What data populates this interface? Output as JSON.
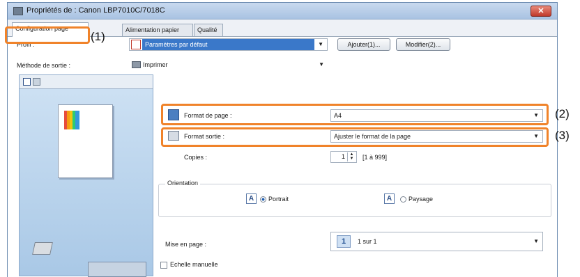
{
  "window": {
    "title": "Propriétés de : Canon LBP7010C/7018C",
    "close_symbol": "✕"
  },
  "tabs": [
    {
      "label": "Configuration page",
      "active": true
    },
    {
      "label": "Alimentation papier",
      "active": false
    },
    {
      "label": "Qualité",
      "active": false
    }
  ],
  "callouts": {
    "one": "(1)",
    "two": "(2)",
    "three": "(3)"
  },
  "profile": {
    "label": "Profil :",
    "value": "Paramètres par défaut",
    "add_button": "Ajouter(1)...",
    "edit_button": "Modifier(2)..."
  },
  "output_method": {
    "label": "Méthode de sortie :",
    "value": "Imprimer"
  },
  "page_size": {
    "label": "Format de page :",
    "value": "A4"
  },
  "output_size": {
    "label": "Format sortie :",
    "value": "Ajuster le format de la page"
  },
  "copies": {
    "label": "Copies :",
    "value": "1",
    "range": "[1 à 999]"
  },
  "orientation": {
    "label": "Orientation",
    "portrait": "Portrait",
    "landscape": "Paysage",
    "selected": "Portrait",
    "icon_letter": "A"
  },
  "layout": {
    "label": "Mise en page :",
    "icon_number": "1",
    "value": "1 sur 1"
  },
  "manual_scale": {
    "label": "Echelle manuelle",
    "checked": false
  },
  "colors": {
    "highlight": "#f0832a",
    "selected_combo_bg": "#3a78c9"
  }
}
